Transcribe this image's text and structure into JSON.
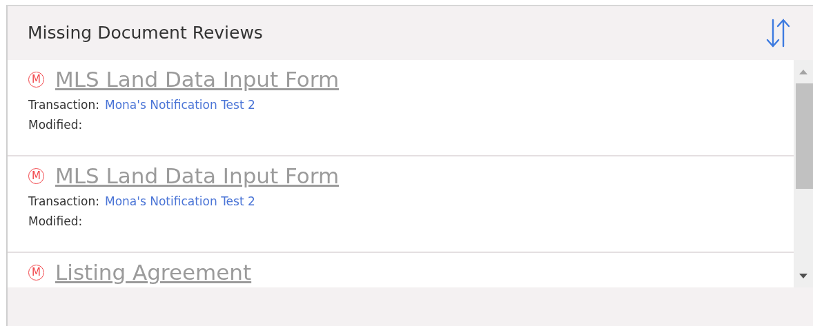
{
  "panel": {
    "title": "Missing Document Reviews"
  },
  "items": [
    {
      "badge": "M",
      "title": "MLS Land Data Input Form",
      "transaction_label": "Transaction:",
      "transaction": "Mona's Notification Test 2",
      "modified_label": "Modified:"
    },
    {
      "badge": "M",
      "title": "MLS Land Data Input Form",
      "transaction_label": "Transaction:",
      "transaction": "Mona's Notification Test 2",
      "modified_label": "Modified:"
    },
    {
      "badge": "M",
      "title": "Listing Agreement"
    }
  ]
}
